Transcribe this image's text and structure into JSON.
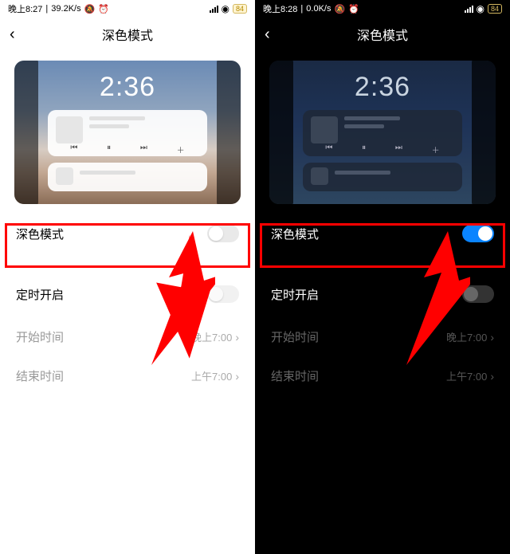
{
  "left": {
    "status": {
      "time": "晚上8:27",
      "net": "39.2K/s",
      "battery": "84"
    },
    "title": "深色模式",
    "preview_time": "2:36",
    "dark_mode": {
      "label": "深色模式",
      "on": false
    },
    "schedule": {
      "label": "定时开启",
      "on": false
    },
    "start": {
      "label": "开始时间",
      "value": "晚上7:00"
    },
    "end": {
      "label": "结束时间",
      "value": "上午7:00"
    }
  },
  "right": {
    "status": {
      "time": "晚上8:28",
      "net": "0.0K/s",
      "battery": "84"
    },
    "title": "深色模式",
    "preview_time": "2:36",
    "dark_mode": {
      "label": "深色模式",
      "on": true
    },
    "schedule": {
      "label": "定时开启",
      "on": false
    },
    "start": {
      "label": "开始时间",
      "value": "晚上7:00"
    },
    "end": {
      "label": "结束时间",
      "value": "上午7:00"
    }
  }
}
